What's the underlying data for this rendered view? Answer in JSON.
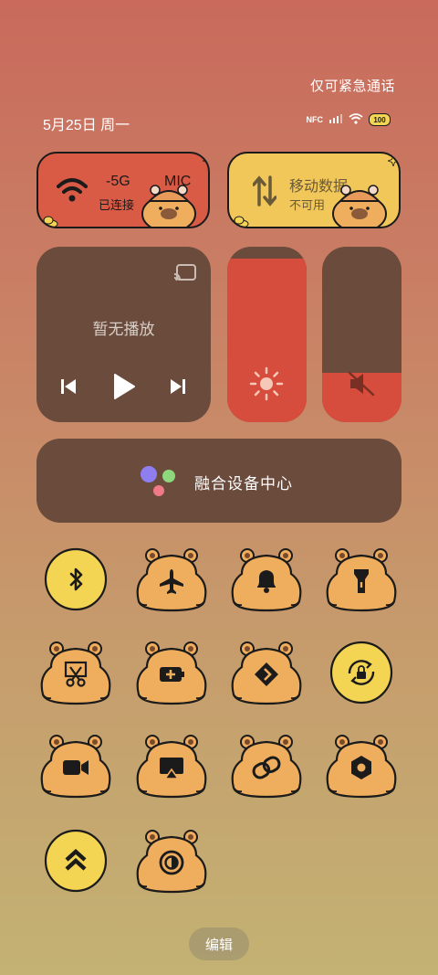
{
  "status": {
    "emergency_text": "仅可紧急通话",
    "date_text": "5月25日 周一",
    "nfc_label": "NFC",
    "battery_level": "100"
  },
  "tiles": {
    "wifi": {
      "title": "-5G",
      "title_suffix": "MIC",
      "status": "已连接",
      "color": "#d95a45"
    },
    "mobile_data": {
      "title": "移动数据",
      "status": "不可用",
      "color": "#f1c75a"
    }
  },
  "media": {
    "title": "暂无播放"
  },
  "sliders": {
    "brightness_level": 0.93,
    "volume_level": 0.28
  },
  "fusion": {
    "label": "融合设备中心"
  },
  "quick_settings": [
    {
      "name": "bluetooth",
      "icon": "bluetooth-icon",
      "active": true
    },
    {
      "name": "airplane",
      "icon": "airplane-icon",
      "active": false
    },
    {
      "name": "notification",
      "icon": "bell-icon",
      "active": false
    },
    {
      "name": "flashlight",
      "icon": "flashlight-icon",
      "active": false
    },
    {
      "name": "screenshot",
      "icon": "scissors-icon",
      "active": false
    },
    {
      "name": "battery-saver",
      "icon": "battery-plus-icon",
      "active": false
    },
    {
      "name": "share",
      "icon": "share-icon",
      "active": false
    },
    {
      "name": "rotation-lock",
      "icon": "rotation-lock-icon",
      "active": true
    },
    {
      "name": "screen-record",
      "icon": "video-camera-icon",
      "active": false
    },
    {
      "name": "screen-cast",
      "icon": "screencast-icon",
      "active": false
    },
    {
      "name": "link",
      "icon": "link-icon",
      "active": false
    },
    {
      "name": "nfc",
      "icon": "hexagon-icon",
      "active": false
    },
    {
      "name": "performance",
      "icon": "double-chevron-up-icon",
      "active": true
    },
    {
      "name": "dark-mode",
      "icon": "contrast-icon",
      "active": false
    }
  ],
  "edit": {
    "label": "编辑"
  },
  "colors": {
    "accent_yellow": "#f4d453",
    "bear_body": "#efad5e",
    "panel_brown": "#6b4b3c",
    "slider_red": "#d64d3d"
  }
}
